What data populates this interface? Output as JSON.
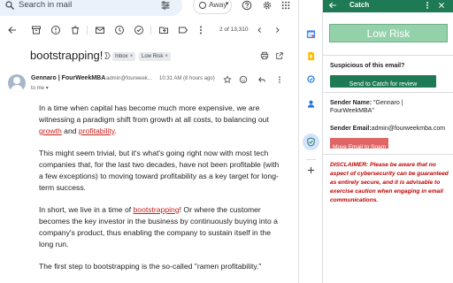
{
  "gmail": {
    "search": {
      "placeholder": "Search in mail"
    },
    "status": {
      "label": "Away"
    },
    "pager": {
      "text": "2 of 13,310"
    },
    "message": {
      "subject": "bootstrapping!",
      "labels": [
        {
          "name": "Inbox",
          "close": "×"
        },
        {
          "name": "Low Risk",
          "close": "×"
        }
      ],
      "sender_name": "Gennaro | FourWeekMBA",
      "sender_email": "admin@fourweek...",
      "time": "10:31 AM (8 hours ago)",
      "recipient": "to me",
      "body": [
        {
          "before": "In a time when capital has become much more expensive, we are witnessing a paradigm shift from growth at all costs, to balancing out ",
          "link1": "growth",
          "middle": " and ",
          "link2": "profitability",
          "after": "."
        },
        {
          "text": "This might seem trivial, but it's what's going right now with most tech companies that, for the last two decades, have not been profitable (with a few exceptions) to moving toward profitability as a key target for long-term success."
        },
        {
          "before": "In short, we live in a time of ",
          "link": "bootstrapping",
          "after": "! Or where the customer becomes the key investor in the business by continuously buying into a company's product, thus enabling the company to sustain itself in the long run."
        },
        {
          "text": "The first step to bootstrapping is the so-called \"ramen profitability.\""
        }
      ]
    }
  },
  "catch_panel": {
    "title": "Catch",
    "risk_label": "Low Risk",
    "question": "Suspicious of this email?",
    "send_button": "Send to Catch for review",
    "sender_name_label": "Sender Name:",
    "sender_name_value": "\"Gennaro | FourWeekMBA\"",
    "sender_email_label": "Sender Email:",
    "sender_email_value": "admin@fourweekmba.com",
    "spam_button": "Move Email to Spam",
    "disclaimer": "DISCLAIMER: Please be aware that no aspect of cybersecurity can be guaranteed as entirely secure, and it is advisable to exercise caution when engaging in email communications."
  },
  "colors": {
    "brand_green": "#1e7a55",
    "risk_green": "#93d1ab",
    "spam_red": "#e06666",
    "disclaimer_red": "#c00000",
    "link_red": "#c5221f"
  },
  "icons": {
    "topbar": [
      "search-icon",
      "filter-icon",
      "help-icon",
      "gear-icon",
      "apps-icon"
    ],
    "toolbar": [
      "back-arrow-icon",
      "archive-icon",
      "report-icon",
      "delete-icon",
      "mark-unread-icon",
      "snooze-icon",
      "add-task-icon",
      "move-to-icon",
      "label-icon",
      "more-icon",
      "prev-icon",
      "next-icon"
    ],
    "strip": [
      "calendar-icon",
      "keep-icon",
      "tasks-icon",
      "contacts-icon",
      "catch-icon",
      "add-icon"
    ]
  }
}
